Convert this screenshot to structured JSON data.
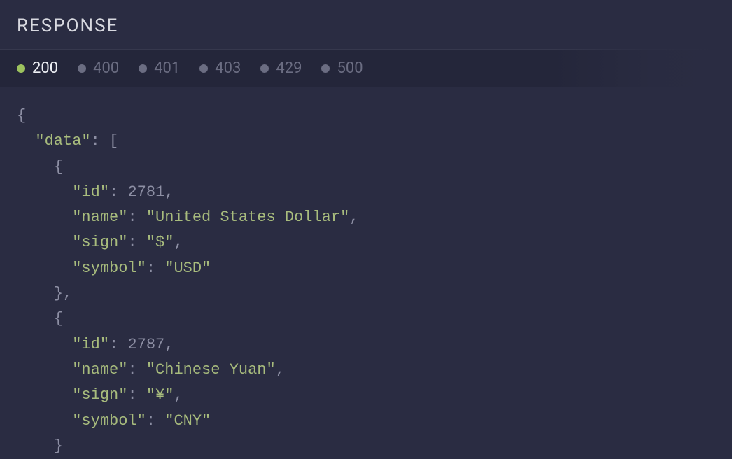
{
  "header": {
    "title": "RESPONSE"
  },
  "tabs": [
    {
      "code": "200",
      "active": true
    },
    {
      "code": "400",
      "active": false
    },
    {
      "code": "401",
      "active": false
    },
    {
      "code": "403",
      "active": false
    },
    {
      "code": "429",
      "active": false
    },
    {
      "code": "500",
      "active": false
    }
  ],
  "code": {
    "open_brace": "{",
    "close_brace": "}",
    "open_bracket": "[",
    "comma": ",",
    "colon": ": ",
    "data_key": "\"data\"",
    "item0": {
      "id_key": "\"id\"",
      "id_val": "2781",
      "name_key": "\"name\"",
      "name_val": "\"United States Dollar\"",
      "sign_key": "\"sign\"",
      "sign_val": "\"$\"",
      "symbol_key": "\"symbol\"",
      "symbol_val": "\"USD\""
    },
    "item1": {
      "id_key": "\"id\"",
      "id_val": "2787",
      "name_key": "\"name\"",
      "name_val": "\"Chinese Yuan\"",
      "sign_key": "\"sign\"",
      "sign_val": "\"¥\"",
      "symbol_key": "\"symbol\"",
      "symbol_val": "\"CNY\""
    }
  }
}
